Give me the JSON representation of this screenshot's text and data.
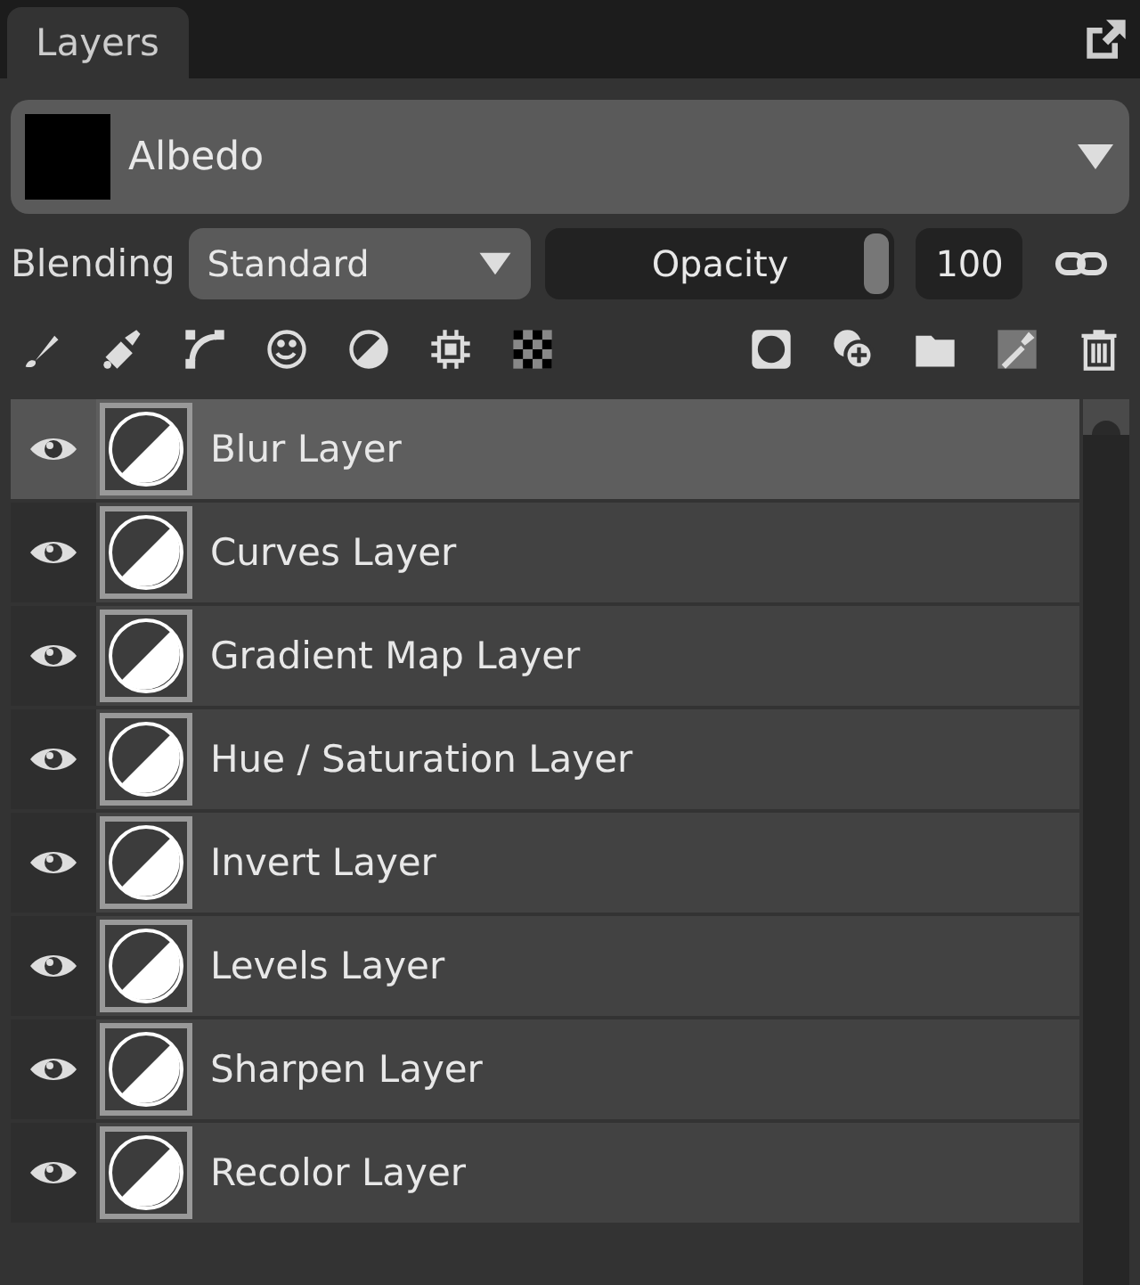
{
  "tabs": [
    {
      "label": "Layers",
      "selected": true
    }
  ],
  "channel": {
    "name": "Albedo",
    "color": "#000000"
  },
  "blending": {
    "label": "Blending",
    "value": "Standard"
  },
  "opacity": {
    "label": "Opacity",
    "level": 1,
    "value": "100"
  },
  "layers": [
    {
      "name": "Blur Layer",
      "selected": true,
      "visible": true
    },
    {
      "name": "Curves Layer",
      "selected": false,
      "visible": true
    },
    {
      "name": "Gradient Map Layer",
      "selected": false,
      "visible": true
    },
    {
      "name": "Hue / Saturation Layer",
      "selected": false,
      "visible": true
    },
    {
      "name": "Invert Layer",
      "selected": false,
      "visible": true
    },
    {
      "name": "Levels Layer",
      "selected": false,
      "visible": true
    },
    {
      "name": "Sharpen Layer",
      "selected": false,
      "visible": true
    },
    {
      "name": "Recolor Layer",
      "selected": false,
      "visible": true
    }
  ]
}
